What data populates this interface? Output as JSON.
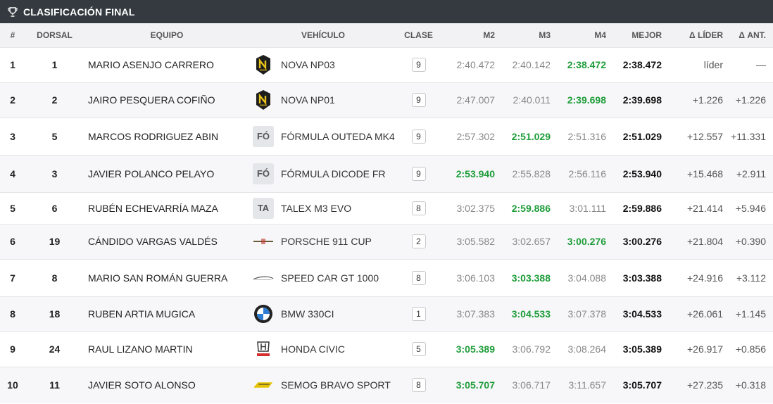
{
  "title": "CLASIFICACIÓN FINAL",
  "headers": {
    "pos": "#",
    "dorsal": "DORSAL",
    "team": "EQUIPO",
    "vehicle": "VEHÍCULO",
    "clase": "CLASE",
    "m2": "M2",
    "m3": "M3",
    "m4": "M4",
    "best": "MEJOR",
    "delta_leader": "Δ LÍDER",
    "delta_prev": "Δ ANT."
  },
  "colors": {
    "header_bar": "#343a40",
    "best_lap_green": "#1e9d3a",
    "stripe": "#f7f7f9"
  },
  "rows": [
    {
      "pos": "1",
      "dorsal": "1",
      "team": "MARIO ASENJO CARRERO",
      "vehicle": "NOVA NP03",
      "logo": "nova-logo-icon",
      "logo_text": "",
      "clase": "9",
      "m2": "2:40.472",
      "m3": "2:40.142",
      "m4": "2:38.472",
      "best_idx": 3,
      "best": "2:38.472",
      "delta_leader": "líder",
      "delta_prev": "—"
    },
    {
      "pos": "2",
      "dorsal": "2",
      "team": "JAIRO PESQUERA COFIÑO",
      "vehicle": "NOVA NP01",
      "logo": "nova-logo-icon",
      "logo_text": "",
      "clase": "9",
      "m2": "2:47.007",
      "m3": "2:40.011",
      "m4": "2:39.698",
      "best_idx": 3,
      "best": "2:39.698",
      "delta_leader": "+1.226",
      "delta_prev": "+1.226"
    },
    {
      "pos": "3",
      "dorsal": "5",
      "team": "MARCOS RODRIGUEZ ABIN",
      "vehicle": "FÓRMULA OUTEDA MK4",
      "logo": "text-logo-icon",
      "logo_text": "FÓ",
      "clase": "9",
      "m2": "2:57.302",
      "m3": "2:51.029",
      "m4": "2:51.316",
      "best_idx": 2,
      "best": "2:51.029",
      "delta_leader": "+12.557",
      "delta_prev": "+11.331"
    },
    {
      "pos": "4",
      "dorsal": "3",
      "team": "JAVIER POLANCO PELAYO",
      "vehicle": "FÓRMULA DICODE FR",
      "logo": "text-logo-icon",
      "logo_text": "FÓ",
      "clase": "9",
      "m2": "2:53.940",
      "m3": "2:55.828",
      "m4": "2:56.116",
      "best_idx": 1,
      "best": "2:53.940",
      "delta_leader": "+15.468",
      "delta_prev": "+2.911"
    },
    {
      "pos": "5",
      "dorsal": "6",
      "team": "RUBÉN ECHEVARRÍA MAZA",
      "vehicle": "TALEX M3 EVO",
      "logo": "text-logo-icon",
      "logo_text": "TA",
      "clase": "8",
      "m2": "3:02.375",
      "m3": "2:59.886",
      "m4": "3:01.111",
      "best_idx": 2,
      "best": "2:59.886",
      "delta_leader": "+21.414",
      "delta_prev": "+5.946"
    },
    {
      "pos": "6",
      "dorsal": "19",
      "team": "CÁNDIDO VARGAS VALDÉS",
      "vehicle": "PORSCHE 911 CUP",
      "logo": "porsche-logo-icon",
      "logo_text": "",
      "clase": "2",
      "m2": "3:05.582",
      "m3": "3:02.657",
      "m4": "3:00.276",
      "best_idx": 3,
      "best": "3:00.276",
      "delta_leader": "+21.804",
      "delta_prev": "+0.390"
    },
    {
      "pos": "7",
      "dorsal": "8",
      "team": "MARIO SAN ROMÁN GUERRA",
      "vehicle": "SPEED CAR GT 1000",
      "logo": "speedcar-logo-icon",
      "logo_text": "",
      "clase": "8",
      "m2": "3:06.103",
      "m3": "3:03.388",
      "m4": "3:04.088",
      "best_idx": 2,
      "best": "3:03.388",
      "delta_leader": "+24.916",
      "delta_prev": "+3.112"
    },
    {
      "pos": "8",
      "dorsal": "18",
      "team": "RUBEN ARTIA MUGICA",
      "vehicle": "BMW 330CI",
      "logo": "bmw-logo-icon",
      "logo_text": "",
      "clase": "1",
      "m2": "3:07.383",
      "m3": "3:04.533",
      "m4": "3:07.378",
      "best_idx": 2,
      "best": "3:04.533",
      "delta_leader": "+26.061",
      "delta_prev": "+1.145"
    },
    {
      "pos": "9",
      "dorsal": "24",
      "team": "RAUL LIZANO MARTIN",
      "vehicle": "HONDA CIVIC",
      "logo": "honda-logo-icon",
      "logo_text": "",
      "clase": "5",
      "m2": "3:05.389",
      "m3": "3:06.792",
      "m4": "3:08.264",
      "best_idx": 1,
      "best": "3:05.389",
      "delta_leader": "+26.917",
      "delta_prev": "+0.856"
    },
    {
      "pos": "10",
      "dorsal": "11",
      "team": "JAVIER SOTO ALONSO",
      "vehicle": "SEMOG BRAVO SPORT",
      "logo": "semog-logo-icon",
      "logo_text": "",
      "clase": "8",
      "m2": "3:05.707",
      "m3": "3:06.717",
      "m4": "3:11.657",
      "best_idx": 1,
      "best": "3:05.707",
      "delta_leader": "+27.235",
      "delta_prev": "+0.318"
    }
  ]
}
